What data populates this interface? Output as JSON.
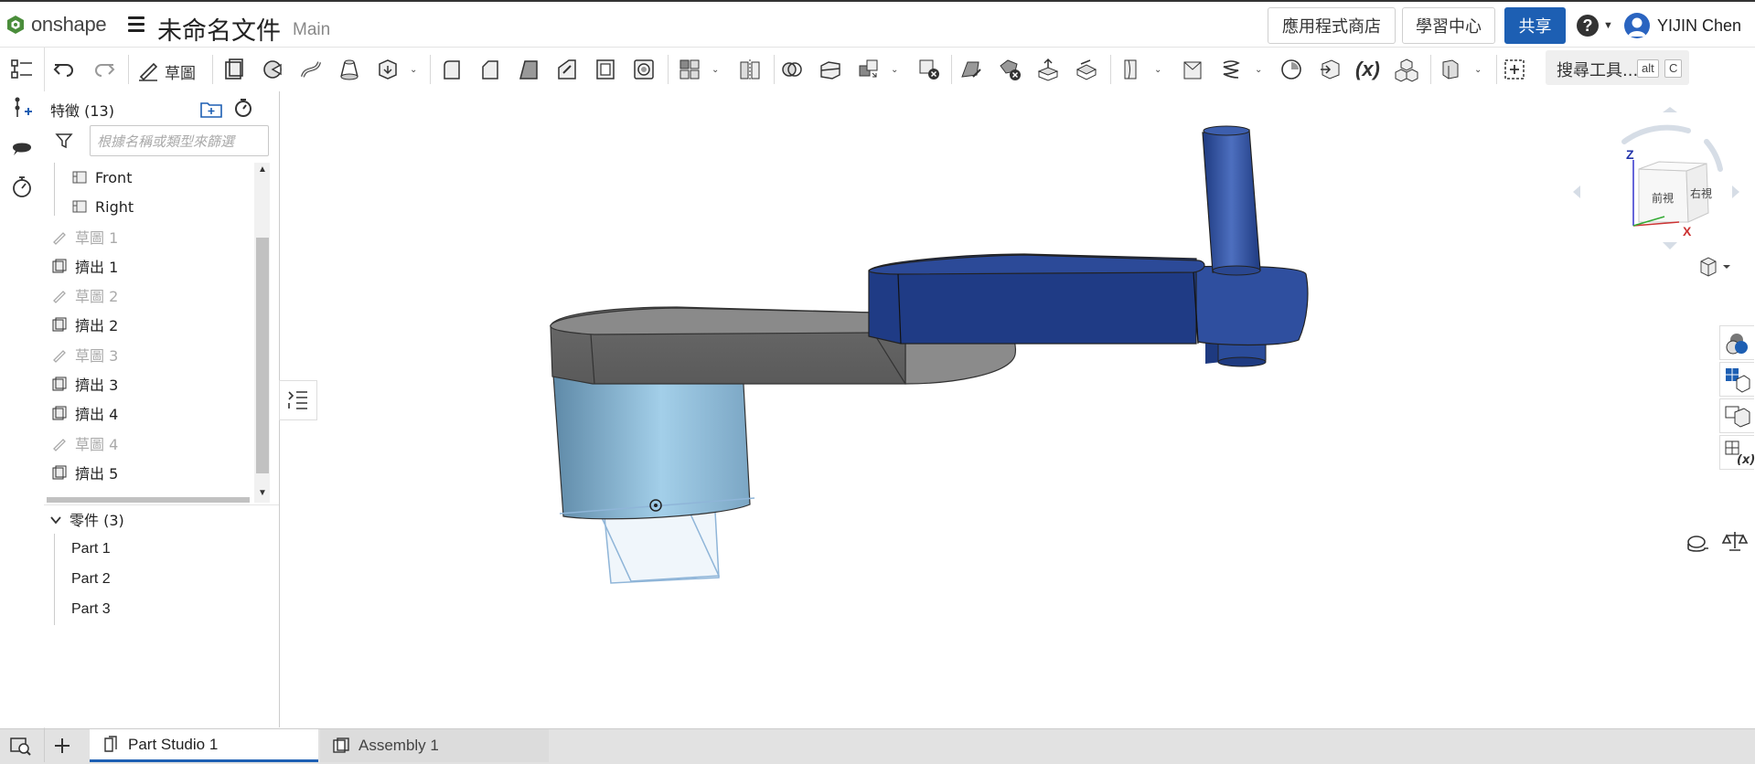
{
  "app": {
    "brand": "onshape",
    "doc_title": "未命名文件",
    "branch": "Main"
  },
  "header": {
    "app_store": "應用程式商店",
    "learning_center": "學習中心",
    "share": "共享",
    "help_symbol": "?",
    "user_name": "YIJIN Chen"
  },
  "toolbar": {
    "sketch_label": "草圖",
    "search_tools": "搜尋工具...",
    "shortcut_key1": "alt",
    "shortcut_key2": "C",
    "variable_symbol": "(x)"
  },
  "features": {
    "title": "特徵 (13)",
    "filter_placeholder": "根據名稱或類型來篩選",
    "items": [
      {
        "label": "Front",
        "kind": "plane",
        "muted": false
      },
      {
        "label": "Right",
        "kind": "plane",
        "muted": false
      },
      {
        "label": "草圖 1",
        "kind": "sketch",
        "muted": true
      },
      {
        "label": "擠出 1",
        "kind": "extrude",
        "muted": false
      },
      {
        "label": "草圖 2",
        "kind": "sketch",
        "muted": true
      },
      {
        "label": "擠出 2",
        "kind": "extrude",
        "muted": false
      },
      {
        "label": "草圖 3",
        "kind": "sketch",
        "muted": true
      },
      {
        "label": "擠出 3",
        "kind": "extrude",
        "muted": false
      },
      {
        "label": "擠出 4",
        "kind": "extrude",
        "muted": false
      },
      {
        "label": "草圖 4",
        "kind": "sketch",
        "muted": true
      },
      {
        "label": "擠出 5",
        "kind": "extrude",
        "muted": false
      }
    ]
  },
  "parts": {
    "title": "零件 (3)",
    "items": [
      "Part 1",
      "Part 2",
      "Part 3"
    ]
  },
  "view_cube": {
    "front": "前視",
    "right": "右視",
    "axis_z": "Z",
    "axis_x": "X"
  },
  "tabs": [
    {
      "label": "Part Studio 1",
      "active": true
    },
    {
      "label": "Assembly 1",
      "active": false
    }
  ],
  "colors": {
    "accent": "#1d5fb3",
    "part_gray": "#6e6e6e",
    "part_blue": "#1f3f8a",
    "part_light": "#9cc7e2"
  }
}
